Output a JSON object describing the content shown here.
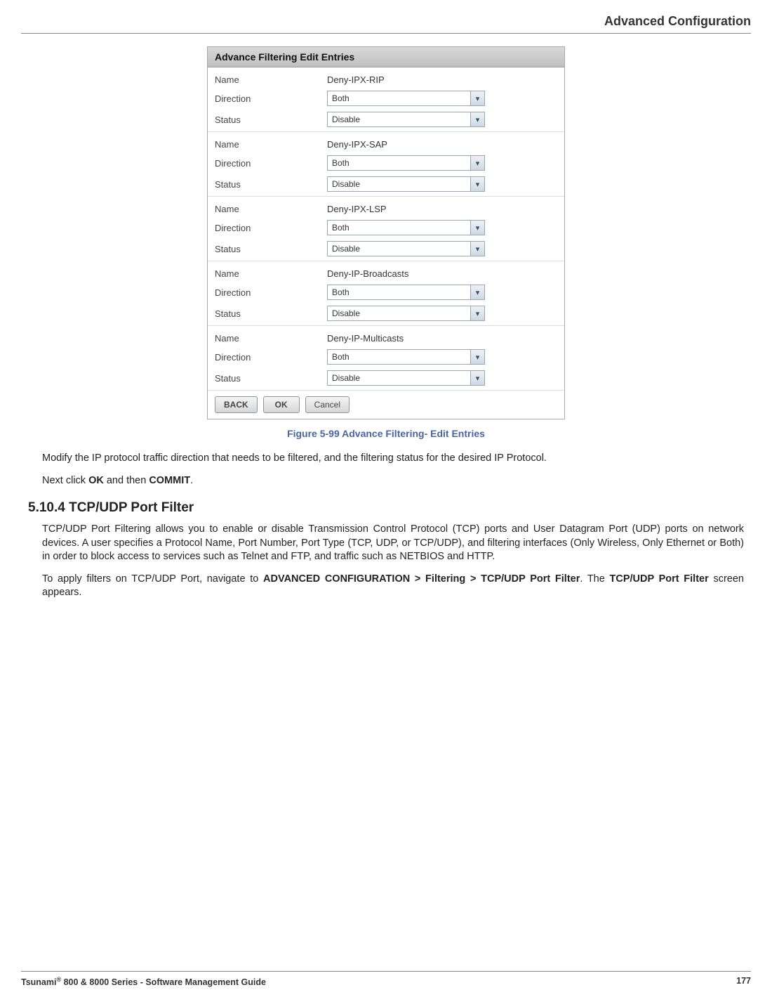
{
  "header": {
    "title": "Advanced Configuration"
  },
  "dialog": {
    "title": "Advance Filtering Edit Entries",
    "labels": {
      "name": "Name",
      "direction": "Direction",
      "status": "Status"
    },
    "buttons": {
      "back": "BACK",
      "ok": "OK",
      "cancel": "Cancel"
    },
    "entries": [
      {
        "name": "Deny-IPX-RIP",
        "direction": "Both",
        "status": "Disable"
      },
      {
        "name": "Deny-IPX-SAP",
        "direction": "Both",
        "status": "Disable"
      },
      {
        "name": "Deny-IPX-LSP",
        "direction": "Both",
        "status": "Disable"
      },
      {
        "name": "Deny-IP-Broadcasts",
        "direction": "Both",
        "status": "Disable"
      },
      {
        "name": "Deny-IP-Multicasts",
        "direction": "Both",
        "status": "Disable"
      }
    ]
  },
  "figure_caption": "Figure 5-99 Advance Filtering- Edit Entries",
  "paragraphs": {
    "p1": "Modify the IP protocol traffic direction that needs to be filtered, and the filtering status for the desired IP Protocol.",
    "p2_prefix": "Next click ",
    "p2_ok": "OK",
    "p2_mid": " and then ",
    "p2_commit": "COMMIT",
    "p2_suffix": ".",
    "section_heading": "5.10.4 TCP/UDP Port Filter",
    "p3": "TCP/UDP Port Filtering allows you to enable or disable Transmission Control Protocol (TCP) ports and User Datagram Port (UDP) ports on network devices. A user specifies a Protocol Name, Port Number, Port Type (TCP, UDP, or TCP/UDP), and filtering interfaces (Only Wireless, Only Ethernet or Both) in order to block access to services such as Telnet and FTP, and traffic such as NETBIOS and HTTP.",
    "p4_prefix": "To apply filters on TCP/UDP Port, navigate to ",
    "p4_bold": "ADVANCED CONFIGURATION > Filtering > TCP/UDP Port Filter",
    "p4_mid": ". The ",
    "p4_bold2": "TCP/UDP Port Filter",
    "p4_suffix": " screen appears."
  },
  "footer": {
    "left_prefix": "Tsunami",
    "left_suffix": " 800 & 8000 Series - Software Management Guide",
    "page": "177"
  }
}
